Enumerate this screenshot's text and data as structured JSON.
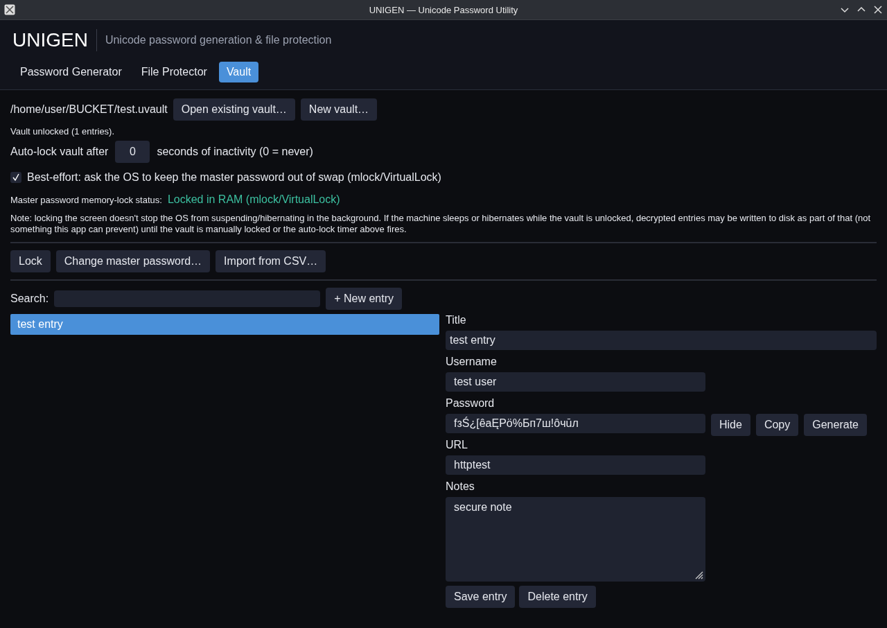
{
  "window": {
    "title": "UNIGEN — Unicode Password Utility"
  },
  "header": {
    "app_name": "UNIGEN",
    "tagline": "Unicode password generation & file protection"
  },
  "tabs": [
    {
      "label": "Password Generator",
      "selected": false
    },
    {
      "label": "File Protector",
      "selected": false
    },
    {
      "label": "Vault",
      "selected": true
    }
  ],
  "vault": {
    "path": "/home/user/BUCKET/test.uvault",
    "buttons": [
      "Open existing vault…",
      "New vault…"
    ],
    "status": "Vault unlocked (1 entries).",
    "autolock": {
      "label_before": "Auto-lock vault after",
      "value": "0",
      "label_after": "seconds of inactivity (0 = never)"
    },
    "mlock_option": {
      "label": "Best-effort: ask the OS to keep the master password out of swap (mlock/VirtualLock)",
      "checked": true
    },
    "memory_status": {
      "label": "Master password memory-lock status:",
      "value": "Locked in RAM (mlock/VirtualLock)"
    },
    "note": "Note: locking the screen doesn't stop the OS from suspending/hibernating in the background. If the machine sleeps or hibernates while the vault is unlocked, decrypted entries may be written to disk as part of that (not something this app can prevent) until the vault is manually locked or the auto-lock timer above fires."
  },
  "actions": [
    "Lock",
    "Change master password…",
    "Import from CSV…"
  ],
  "search": {
    "label": "Search:",
    "new_button": "+ New entry"
  },
  "entries": [
    {
      "title": "test entry",
      "selected": true
    }
  ],
  "editor": {
    "fields": [
      {
        "kind": "wide",
        "label": "Title",
        "value": "test entry"
      },
      {
        "kind": "text",
        "label": "Username",
        "value": "test user"
      },
      {
        "kind": "password",
        "label": "Password",
        "value": "fзŚ¿[êaĘPö%Бп7ш!ôчūл",
        "buttons": [
          "Hide",
          "Copy",
          "Generate"
        ]
      },
      {
        "kind": "text",
        "label": "URL",
        "value": "httptest"
      },
      {
        "kind": "notes",
        "label": "Notes",
        "value": "secure note"
      }
    ],
    "buttons": [
      "Save entry",
      "Delete entry"
    ]
  }
}
